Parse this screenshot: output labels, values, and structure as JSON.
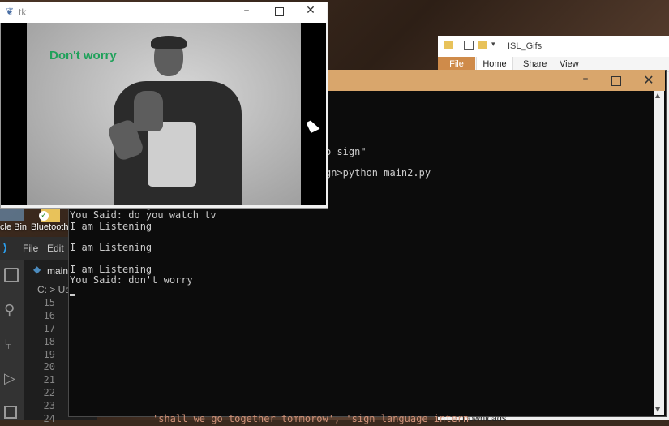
{
  "desktop": {
    "icons": [
      {
        "label": "cle Bin"
      },
      {
        "label": "Bluetooth_"
      }
    ]
  },
  "tk_window": {
    "title": "tk",
    "caption": "Don't worry"
  },
  "explorer": {
    "title": "ISL_Gifs",
    "tabs": [
      "File",
      "Home",
      "Share",
      "View"
    ],
    "sidebar_bottom": "Downloads"
  },
  "vscode": {
    "menu": [
      "File",
      "Edit"
    ],
    "tab_label": "main.",
    "breadcrumb": "C: > Use",
    "line_numbers": [
      "15",
      "16",
      "17",
      "18",
      "19",
      "20",
      "21",
      "22",
      "23",
      "24"
    ]
  },
  "console": {
    "partial_lines": [
      {
        "text": "o sign\""
      },
      {
        "text": "gn>python main2.py"
      }
    ],
    "lines": [
      "I am Listening",
      "You Said: do you watch tv",
      "I am Listening",
      "",
      "I am Listening",
      "",
      "I am Listening",
      "You Said: don't worry"
    ],
    "bottom_text": "'shall we go together tommorow', 'sign language intern"
  },
  "colors": {
    "caption": "#1fa15a",
    "console_bg": "#0c0c0c",
    "console_title": "#d9a66c",
    "explorer_file_tab": "#cf8b4a"
  }
}
